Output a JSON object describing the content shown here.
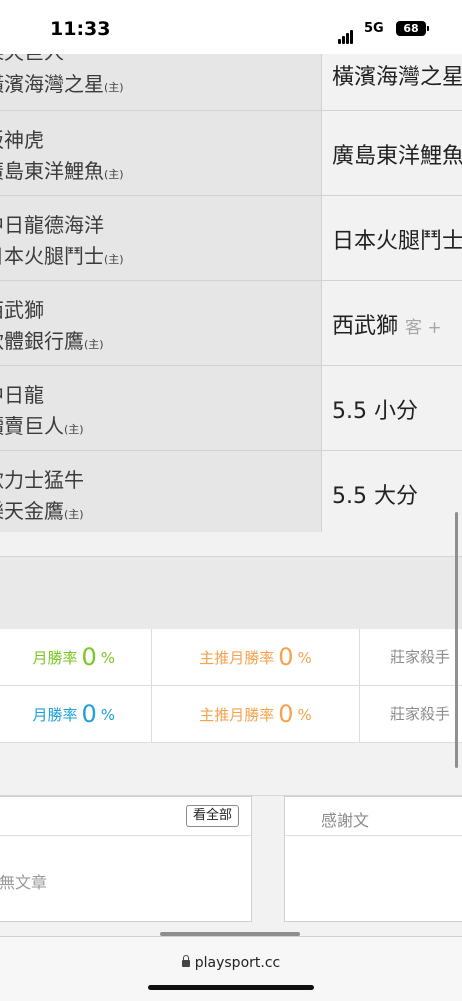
{
  "status_bar": {
    "time": "11:33",
    "network": "5G",
    "battery": "68"
  },
  "games": [
    {
      "team_top": "樂天巨人",
      "team_bottom": "橫濱海灣之星",
      "host_mark": "(主)",
      "pick": "橫濱海灣之星",
      "pick_extra": ""
    },
    {
      "team_top": "阪神虎",
      "team_bottom": "廣島東洋鯉魚",
      "host_mark": "(主)",
      "pick": "廣島東洋鯉魚",
      "pick_extra": ""
    },
    {
      "team_top": "中日龍德海洋",
      "team_bottom": "日本火腿鬥士",
      "host_mark": "(主)",
      "pick": "日本火腿鬥士",
      "pick_extra": ""
    },
    {
      "team_top": "西武獅",
      "team_bottom": "軟體銀行鷹",
      "host_mark": "(主)",
      "pick": "西武獅",
      "pick_extra": "客 +"
    },
    {
      "team_top": "中日龍",
      "team_bottom": "讀賣巨人",
      "host_mark": "(主)",
      "pick": "5.5 小分",
      "pick_extra": ""
    },
    {
      "team_top": "歐力士猛牛",
      "team_bottom": "樂天金鷹",
      "host_mark": "(主)",
      "pick": "5.5 大分",
      "pick_extra": ""
    }
  ],
  "rates": [
    {
      "col1_label": "月勝率",
      "col1_value": "0",
      "col1_unit": "%",
      "col2_label": "主推月勝率",
      "col2_value": "0",
      "col2_unit": "%",
      "col3_label": "莊家殺手"
    },
    {
      "col1_label": "月勝率",
      "col1_value": "0",
      "col1_unit": "%",
      "col2_label": "主推月勝率",
      "col2_value": "0",
      "col2_unit": "%",
      "col3_label": "莊家殺手"
    }
  ],
  "articles": {
    "see_all_label": "看全部",
    "empty_text": "無文章"
  },
  "thanks": {
    "title": "感謝文"
  },
  "browser": {
    "url": "playsport.cc"
  },
  "colors": {
    "green": "#7cc623",
    "blue": "#1da1d8",
    "orange": "#f7a14c"
  }
}
